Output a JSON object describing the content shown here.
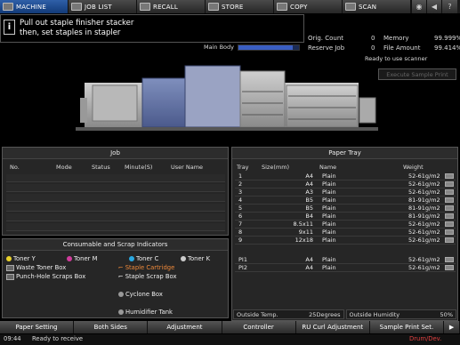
{
  "tabs": [
    {
      "label": "MACHINE",
      "icon": "machine-icon"
    },
    {
      "label": "JOB LIST",
      "icon": "job-list-icon"
    },
    {
      "label": "RECALL",
      "icon": "recall-icon"
    },
    {
      "label": "STORE",
      "icon": "store-icon"
    },
    {
      "label": "COPY",
      "icon": "copy-icon"
    },
    {
      "label": "SCAN",
      "icon": "scan-icon"
    }
  ],
  "message": {
    "line1": "Pull out staple finisher stacker",
    "line2": "then, set staples in stapler"
  },
  "counters": {
    "orig_count_label": "Orig. Count",
    "orig_count": "0",
    "memory_label": "Memory",
    "memory": "99.999%",
    "reserve_job_label": "Reserve Job",
    "reserve_job": "0",
    "file_amount_label": "File Amount",
    "file_amount": "99.414%"
  },
  "main_body": {
    "label": "Main Body",
    "level": 0.9
  },
  "ready_text": "Ready to use scanner",
  "execute_sample_print": "Execute Sample Print",
  "job_panel": {
    "title": "Job",
    "columns": [
      "No.",
      "Mode",
      "Status",
      "Minute(S)",
      "User Name"
    ]
  },
  "consumables": {
    "title": "Consumable and Scrap Indicators",
    "items": [
      {
        "label": "Toner Y",
        "color": "#e8d02a"
      },
      {
        "label": "Toner M",
        "color": "#d03c9c"
      },
      {
        "label": "Toner C",
        "color": "#2aa8e0"
      },
      {
        "label": "Toner K",
        "color": "#cccccc"
      },
      {
        "label": "Waste Toner Box",
        "color": "#999999"
      },
      {
        "label": "Staple Cartridge",
        "color": "#e8702a"
      },
      {
        "label": "Punch-Hole Scraps Box",
        "color": "#999999"
      },
      {
        "label": "Staple Scrap Box",
        "color": "#999999"
      },
      {
        "label": "Cyclone Box",
        "color": "#999999"
      },
      {
        "label": "Humidifier Tank",
        "color": "#999999"
      }
    ]
  },
  "paper_tray": {
    "title": "Paper Tray",
    "columns": [
      "Tray",
      "Size(mm)",
      "Name",
      "Weight"
    ],
    "rows": [
      {
        "tray": "1",
        "size": "A4",
        "name": "Plain",
        "weight": "52-61g/m2"
      },
      {
        "tray": "2",
        "size": "A4",
        "name": "Plain",
        "weight": "52-61g/m2"
      },
      {
        "tray": "3",
        "size": "A3",
        "name": "Plain",
        "weight": "52-61g/m2"
      },
      {
        "tray": "4",
        "size": "B5",
        "name": "Plain",
        "weight": "81-91g/m2"
      },
      {
        "tray": "5",
        "size": "B5",
        "name": "Plain",
        "weight": "81-91g/m2"
      },
      {
        "tray": "6",
        "size": "B4",
        "name": "Plain",
        "weight": "81-91g/m2"
      },
      {
        "tray": "7",
        "size": "8.5x11",
        "name": "Plain",
        "weight": "52-61g/m2"
      },
      {
        "tray": "8",
        "size": "9x11",
        "name": "Plain",
        "weight": "52-61g/m2"
      },
      {
        "tray": "9",
        "size": "12x18",
        "name": "Plain",
        "weight": "52-61g/m2"
      },
      {
        "tray": "PI1",
        "size": "A4",
        "name": "Plain",
        "weight": "52-61g/m2"
      },
      {
        "tray": "PI2",
        "size": "A4",
        "name": "Plain",
        "weight": "52-61g/m2"
      }
    ],
    "outside_temp_label": "Outside Temp.",
    "outside_temp": "25Degrees",
    "outside_humidity_label": "Outside Humidity",
    "outside_humidity": "50%"
  },
  "bottom_buttons": [
    "Paper Setting",
    "Both Sides",
    "Adjustment",
    "Controller",
    "RU Curl Adjustment",
    "Sample Print Set."
  ],
  "status": {
    "time": "09:44",
    "text": "Ready to receive",
    "drum": "Drum/Dev."
  }
}
